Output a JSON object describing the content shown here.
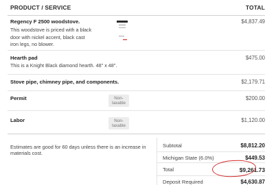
{
  "header": {
    "product_label": "PRODUCT / SERVICE",
    "total_label": "TOTAL"
  },
  "items": [
    {
      "name": "Regency F 2500 woodstove.",
      "description_lines": [
        "This woodstove is priced with a black",
        "door with nickel accent, black cast",
        "iron legs, no blower."
      ],
      "price": "$4,837.49"
    },
    {
      "name": "Hearth pad",
      "description_lines": [
        "This is a Knight Black diamond hearth. 48\" x 48\"."
      ],
      "price": "$475.00"
    },
    {
      "name": "Stove pipe, chimney pipe, and components.",
      "price": "$2,179.71"
    },
    {
      "name": "Permit",
      "tax_badge": [
        "Non-",
        "taxable"
      ],
      "price": "$200.00"
    },
    {
      "name": "Labor",
      "tax_badge": [
        "Non-",
        "taxable"
      ],
      "price": "$1,120.00"
    }
  ],
  "note": "Estimates are good for 60 days unless there is an increase in materials cost.",
  "summary": [
    {
      "label": "Subtotal",
      "value": "$8,812.20"
    },
    {
      "label": "Michigan State (6.0%)",
      "value": "$449.53"
    },
    {
      "label": "Total",
      "value": "$9,261.73"
    },
    {
      "label": "Deposit Required",
      "value": "$4,630.87"
    }
  ],
  "colors": {
    "annotation": "#d32a2a",
    "divider": "#e3e3e3"
  },
  "icons": {
    "product_thumbnail": "woodstove-thumbnail-icon"
  }
}
